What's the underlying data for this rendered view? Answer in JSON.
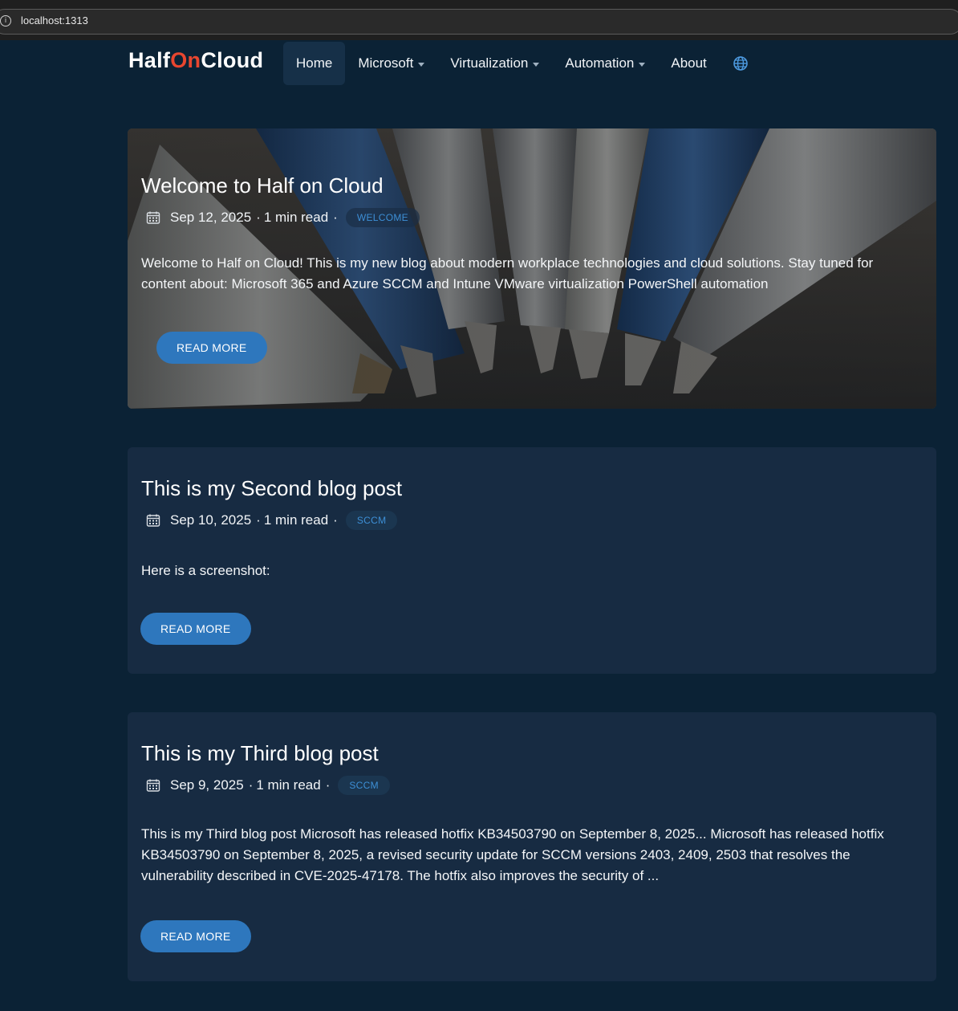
{
  "browser": {
    "url": "localhost:1313",
    "info_icon": "info-icon"
  },
  "site": {
    "logo_part1": "Half",
    "logo_part2": "On",
    "logo_part3": "Cloud",
    "accent_color": "#e8462f"
  },
  "nav": {
    "items": [
      {
        "label": "Home",
        "active": true
      },
      {
        "label": "Microsoft",
        "dropdown": true
      },
      {
        "label": "Virtualization",
        "dropdown": true
      },
      {
        "label": "Automation",
        "dropdown": true
      },
      {
        "label": "About"
      }
    ],
    "language_icon": "globe-icon"
  },
  "posts": [
    {
      "title": "Welcome to Half on Cloud",
      "date": "Sep 12, 2025",
      "read_time": "1 min read",
      "tag": "WELCOME",
      "excerpt": "Welcome to Half on Cloud! This is my new blog about modern workplace technologies and cloud solutions. Stay tuned for content about: Microsoft 365 and Azure SCCM and Intune VMware virtualization PowerShell automation",
      "button": "READ MORE"
    },
    {
      "title": "This is my Second blog post",
      "date": "Sep 10, 2025",
      "read_time": "1 min read",
      "tag": "SCCM",
      "excerpt": "Here is a screenshot:",
      "button": "READ MORE"
    },
    {
      "title": "This is my Third blog post",
      "date": "Sep 9, 2025",
      "read_time": "1 min read",
      "tag": "SCCM",
      "excerpt": "This is my Third blog post Microsoft has released hotfix KB34503790 on September 8, 2025... Microsoft has released hotfix KB34503790 on September 8, 2025, a revised security update for SCCM versions 2403, 2409, 2503 that resolves the vulnerability described in CVE-2025-47178. The hotfix also improves the security of ...",
      "button": "READ MORE"
    }
  ],
  "meta_separator": "·",
  "button_color": "#2e77bd",
  "background_color": "#0b2235",
  "card_color": "#172b42"
}
